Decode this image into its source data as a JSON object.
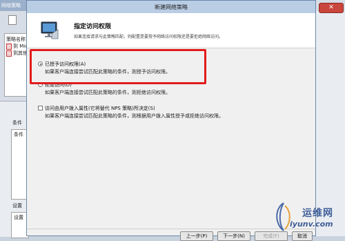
{
  "background": {
    "window_title": "网络策略",
    "policy_name_header": "策略名称",
    "policy_rows": [
      "到 Mic",
      "到其他"
    ],
    "conditions_label": "条件",
    "conditions_col": "条件",
    "settings_label": "设置",
    "settings_col": "设置",
    "close_glyph": "✕"
  },
  "dialog": {
    "title": "新建网络策略",
    "heading": "指定访问权限",
    "subheading": "如果连接请求与此策略匹配，则配置是要授予网络访问权限还是要拒绝网络访问。",
    "options": [
      {
        "type": "radio",
        "checked": true,
        "label": "已授予访问权限(A)",
        "description": "如果客户端连接尝试匹配此策略的条件，则授予访问权限。"
      },
      {
        "type": "radio",
        "checked": false,
        "label": "拒绝访问(D)",
        "description": "如果客户端连接尝试匹配此策略的条件，则拒绝访问权限。"
      },
      {
        "type": "checkbox",
        "checked": false,
        "label": "访问由用户拨入属性(它将替代 NPS 策略)所决定(S)",
        "description": "如果客户端连接尝试匹配此策略的条件，则根据用户拨入属性授予或拒绝访问权限。"
      }
    ],
    "buttons": {
      "back": "上一步(P)",
      "next": "下一步(N)",
      "finish": "完成(F)",
      "cancel": "取消"
    }
  },
  "watermark": {
    "site_name": "运维网",
    "url": "iyunv.com"
  },
  "colors": {
    "highlight": "#e21b1b",
    "titlebar": "#b9cde5"
  }
}
